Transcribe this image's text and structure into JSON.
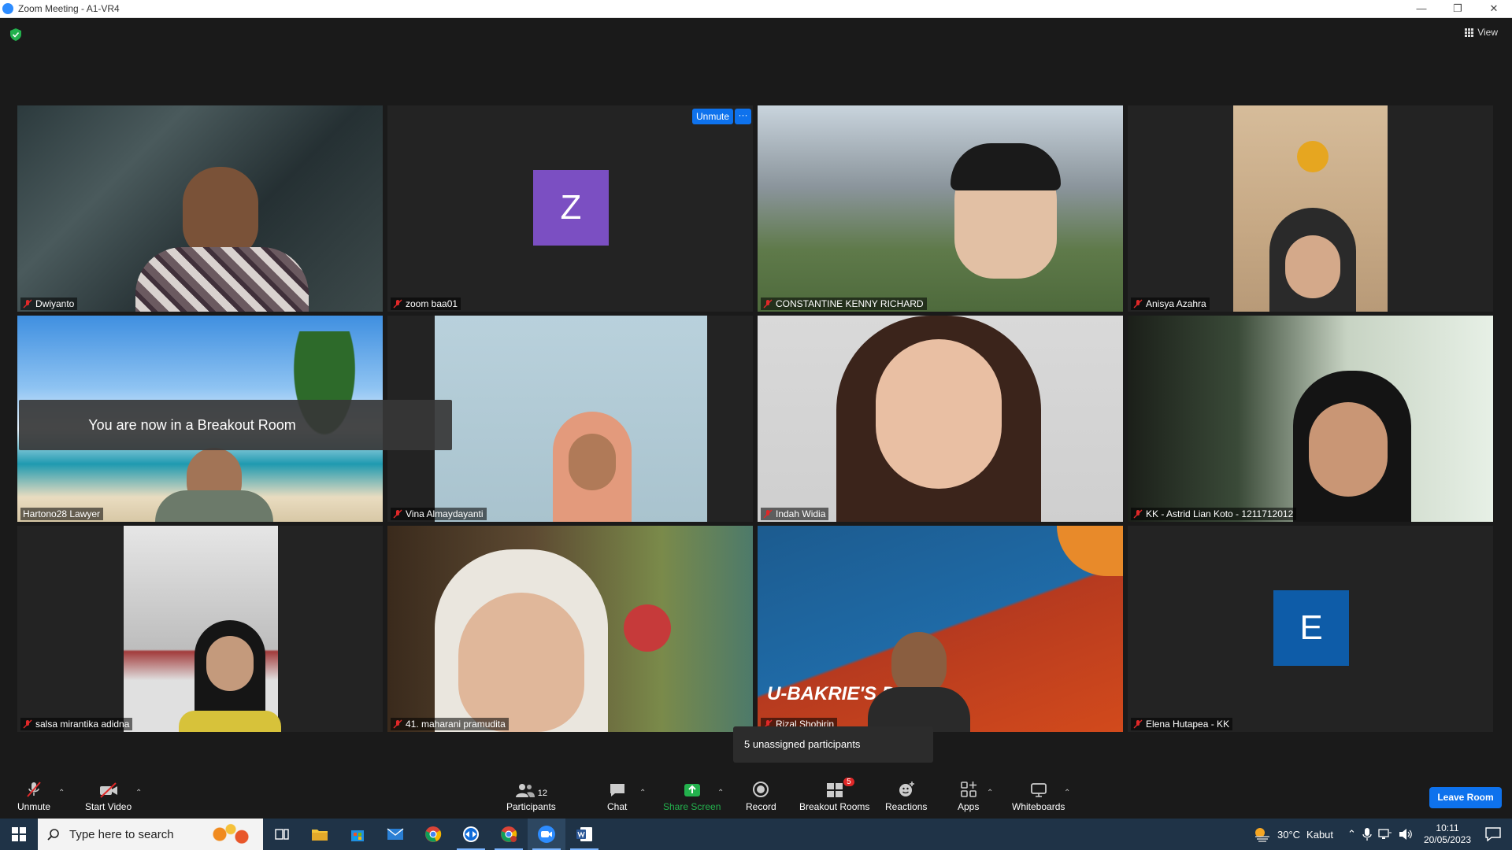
{
  "window": {
    "title": "Zoom Meeting - A1-VR4",
    "view_label": "View",
    "minimize": "—",
    "restore": "❐",
    "close": "✕"
  },
  "tiles": [
    {
      "name": "Dwiyanto",
      "muted": true
    },
    {
      "name": "zoom baa01",
      "muted": true,
      "avatar_letter": "Z",
      "avatar_color": "#7b4fc2"
    },
    {
      "name": "CONSTANTINE KENNY RICHARD",
      "muted": true
    },
    {
      "name": "Anisya Azahra",
      "muted": true
    },
    {
      "name": "Hartono28 Lawyer",
      "muted": false,
      "active": true
    },
    {
      "name": "Vina Almaydayanti",
      "muted": true
    },
    {
      "name": "Indah Widia",
      "muted": true
    },
    {
      "name": "KK - Astrid Lian Koto - 1211712012",
      "muted": true
    },
    {
      "name": "salsa mirantika adidna",
      "muted": true
    },
    {
      "name": "41. maharani pramudita",
      "muted": true
    },
    {
      "name": "Rizal Shobirin",
      "muted": true
    },
    {
      "name": "Elena Hutapea - KK",
      "muted": true,
      "avatar_letter": "E",
      "avatar_color": "#0e5ca8"
    }
  ],
  "overlays": {
    "breakout_toast": "You are now in a Breakout Room",
    "unmute_pill": "Unmute",
    "more_pill": "···",
    "unassigned_tooltip": "5 unassigned participants",
    "background_text": "U-BAKRIE'S DAY"
  },
  "toolbar": {
    "unmute": "Unmute",
    "start_video": "Start Video",
    "participants": "Participants",
    "participants_count": "12",
    "chat": "Chat",
    "share_screen": "Share Screen",
    "record": "Record",
    "breakout_rooms": "Breakout Rooms",
    "breakout_badge": "5",
    "reactions": "Reactions",
    "apps": "Apps",
    "whiteboards": "Whiteboards",
    "leave_room": "Leave Room"
  },
  "taskbar": {
    "search_placeholder": "Type here to search",
    "weather_temp": "30°C",
    "weather_desc": "Kabut",
    "time": "10:11",
    "date": "20/05/2023"
  },
  "colors": {
    "accent": "#0e72ed",
    "share_green": "#23b14d",
    "active_speaker": "#c7d94a"
  }
}
